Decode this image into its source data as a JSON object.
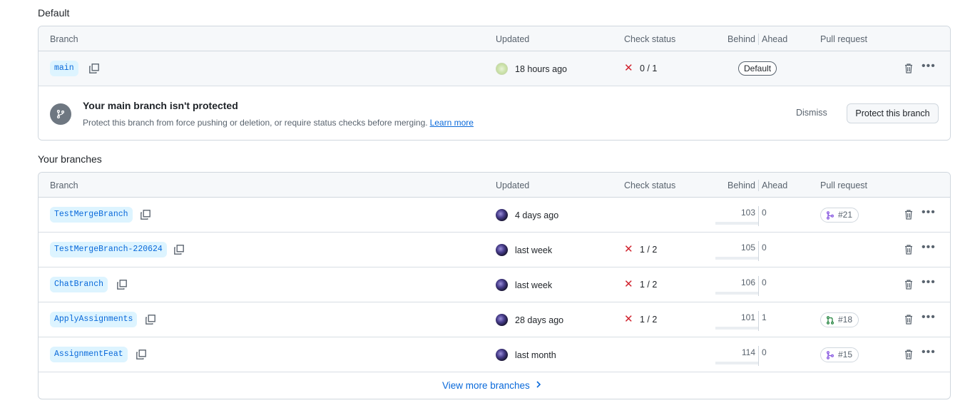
{
  "default_section": {
    "title": "Default",
    "headers": {
      "branch": "Branch",
      "updated": "Updated",
      "check": "Check status",
      "behind": "Behind",
      "ahead": "Ahead",
      "pr": "Pull request"
    },
    "row": {
      "branch": "main",
      "updated": "18 hours ago",
      "check": "0 / 1",
      "badge": "Default"
    },
    "protect": {
      "title": "Your main branch isn't protected",
      "description": "Protect this branch from force pushing or deletion, or require status checks before merging.",
      "learn_more": "Learn more",
      "dismiss": "Dismiss",
      "button": "Protect this branch"
    }
  },
  "your_branches": {
    "title": "Your branches",
    "headers": {
      "branch": "Branch",
      "updated": "Updated",
      "check": "Check status",
      "behind": "Behind",
      "ahead": "Ahead",
      "pr": "Pull request"
    },
    "rows": [
      {
        "branch": "TestMergeBranch",
        "updated": "4 days ago",
        "check": "",
        "behind": "103",
        "ahead": "0",
        "pr": "#21",
        "pr_state": "merged"
      },
      {
        "branch": "TestMergeBranch-220624",
        "updated": "last week",
        "check": "1 / 2",
        "behind": "105",
        "ahead": "0",
        "pr": "",
        "pr_state": ""
      },
      {
        "branch": "ChatBranch",
        "updated": "last week",
        "check": "1 / 2",
        "behind": "106",
        "ahead": "0",
        "pr": "",
        "pr_state": ""
      },
      {
        "branch": "ApplyAssignments",
        "updated": "28 days ago",
        "check": "1 / 2",
        "behind": "101",
        "ahead": "1",
        "pr": "#18",
        "pr_state": "open"
      },
      {
        "branch": "AssignmentFeat",
        "updated": "last month",
        "check": "",
        "behind": "114",
        "ahead": "0",
        "pr": "#15",
        "pr_state": "merged"
      }
    ],
    "view_more": "View more branches"
  },
  "colors": {
    "accent": "#0969da",
    "danger": "#d1242f",
    "merged": "#8250df",
    "open": "#1a7f37"
  }
}
